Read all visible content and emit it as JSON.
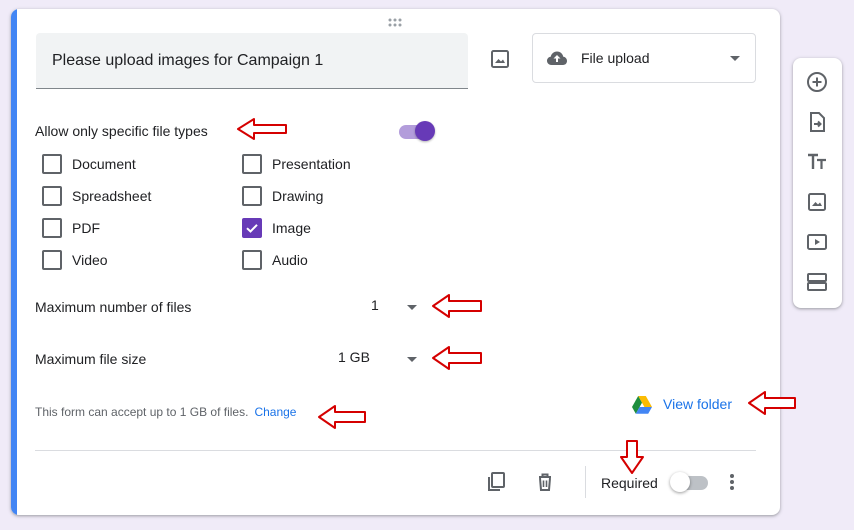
{
  "question": {
    "title": "Please upload images for Campaign 1",
    "type_label": "File upload"
  },
  "file_types": {
    "label": "Allow only specific file types",
    "toggle_on": true,
    "options": [
      {
        "label": "Document",
        "checked": false
      },
      {
        "label": "Presentation",
        "checked": false
      },
      {
        "label": "Spreadsheet",
        "checked": false
      },
      {
        "label": "Drawing",
        "checked": false
      },
      {
        "label": "PDF",
        "checked": false
      },
      {
        "label": "Image",
        "checked": true
      },
      {
        "label": "Video",
        "checked": false
      },
      {
        "label": "Audio",
        "checked": false
      }
    ]
  },
  "max_files": {
    "label": "Maximum number of files",
    "value": "1"
  },
  "max_size": {
    "label": "Maximum file size",
    "value": "1 GB"
  },
  "note": {
    "text": "This form can accept up to 1 GB of files.",
    "link": "Change"
  },
  "view_folder": {
    "label": "View folder"
  },
  "footer": {
    "required_label": "Required",
    "required_on": false
  },
  "colors": {
    "accent": "#673ab7",
    "card_accent": "#4285f4",
    "link": "#1a73e8",
    "annotation_arrow": "#d50000"
  },
  "icons": {
    "question_image": "image-icon",
    "type": "cloud-upload-icon",
    "folder": "google-drive-icon",
    "duplicate": "copy-icon",
    "delete": "trash-icon",
    "more": "more-vert-icon",
    "toolbar": [
      "add-circle-icon",
      "import-icon",
      "title-icon",
      "image-icon",
      "video-icon",
      "section-icon"
    ]
  }
}
